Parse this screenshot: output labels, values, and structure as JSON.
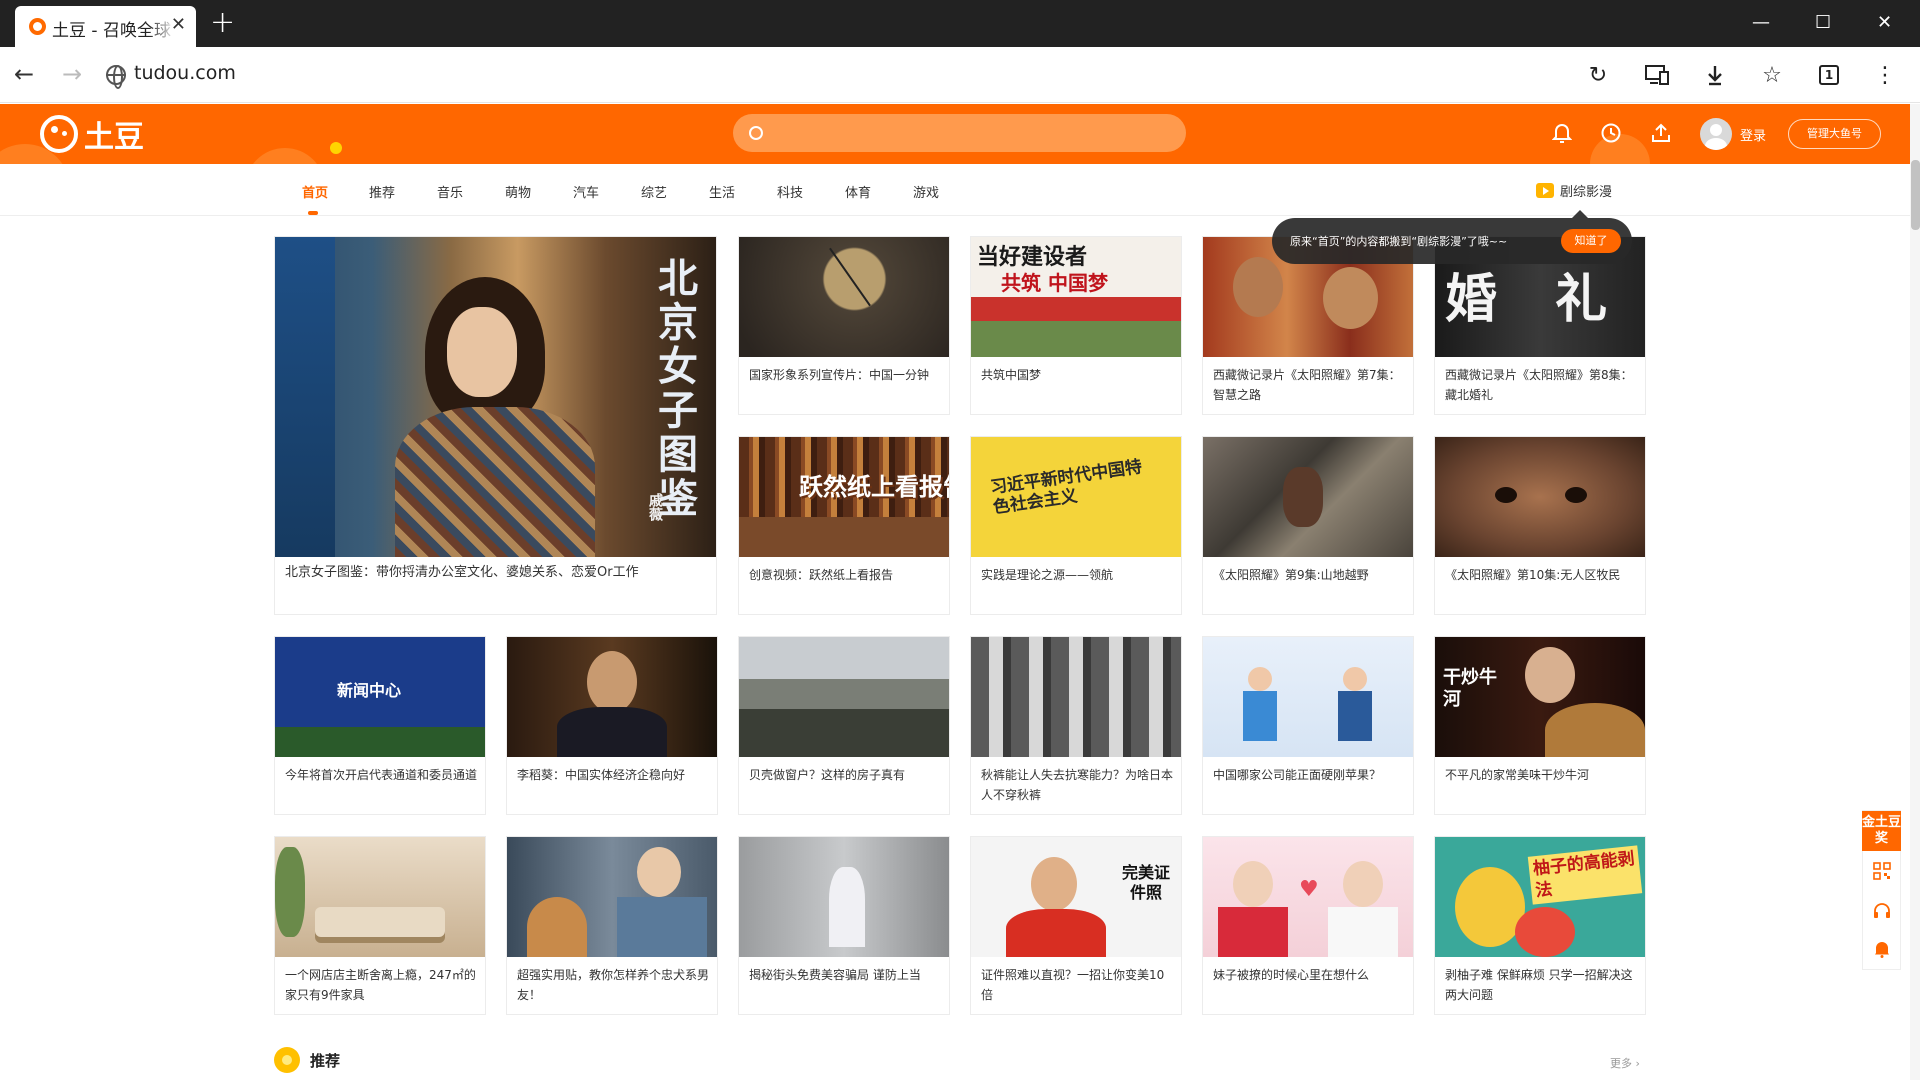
{
  "browser": {
    "tab_title": "土豆 - 召唤全球",
    "tab_close": "✕",
    "new_tab": "+",
    "url": "tudou.com",
    "win_minimize": "—",
    "win_maximize": "☐",
    "win_close": "✕",
    "tab_count": "1"
  },
  "header": {
    "logo_text": "土豆",
    "search_placeholder": "",
    "login_label": "登录",
    "manager_button": "管理大鱼号"
  },
  "nav": {
    "items": [
      "首页",
      "推荐",
      "音乐",
      "萌物",
      "汽车",
      "综艺",
      "生活",
      "科技",
      "体育",
      "游戏"
    ],
    "active_index": 0,
    "drama_label": "剧综影漫"
  },
  "tooltip": {
    "text": "原来“首页”的内容都搬到“剧综影漫”了哦~~",
    "button": "知道了"
  },
  "videos": {
    "featured": {
      "title": "北京女子图鉴：带你捋清办公室文化、婆媳关系、恋爱Or工作",
      "overlay": "北京女子图鉴",
      "overlay_credit": "戚薇"
    },
    "row1": [
      {
        "title": "国家形象系列宣传片：中国一分钟"
      },
      {
        "title": "共筑中国梦",
        "overlay_top": "当好建设者",
        "overlay_bottom": "共筑 中国梦"
      },
      {
        "title": "西藏微记录片《太阳照耀》第7集：智慧之路"
      },
      {
        "title": "西藏微记录片《太阳照耀》第8集：藏北婚礼",
        "overlay": "婚 礼"
      }
    ],
    "row2": [
      {
        "title": "创意视频：跃然纸上看报告",
        "overlay": "跃然纸上看报告"
      },
      {
        "title": "实践是理论之源——领航",
        "overlay": "习近平新时代中国特色社会主义"
      },
      {
        "title": "《太阳照耀》第9集:山地越野"
      },
      {
        "title": "《太阳照耀》第10集:无人区牧民"
      }
    ],
    "row3": [
      {
        "title": "今年将首次开启代表通道和委员通道",
        "overlay": "新闻中心"
      },
      {
        "title": "李稻葵：中国实体经济企稳向好"
      },
      {
        "title": "贝壳做窗户？这样的房子真有"
      },
      {
        "title": "秋裤能让人失去抗寒能力？为啥日本人不穿秋裤"
      },
      {
        "title": "中国哪家公司能正面硬刚苹果？"
      },
      {
        "title": "不平凡的家常美味干炒牛河",
        "overlay": "干炒牛河"
      }
    ],
    "row4": [
      {
        "title": "一个网店店主断舍离上瘾，247㎡的家只有9件家具"
      },
      {
        "title": "超强实用贴，教你怎样养个忠犬系男友！"
      },
      {
        "title": "揭秘街头免费美容骗局 谨防上当"
      },
      {
        "title": "证件照难以直视？一招让你变美10倍",
        "overlay": "完美证件照"
      },
      {
        "title": "妹子被撩的时候心里在想什么"
      },
      {
        "title": "剥柚子难 保鲜麻烦 只学一招解决这两大问题",
        "overlay": "柚子的高能剥法"
      }
    ]
  },
  "section": {
    "title": "推荐",
    "more": "更多 ›"
  },
  "side_widget": {
    "label": "金土豆奖"
  },
  "colors": {
    "brand": "#ff6700",
    "tab_bar": "#222222"
  },
  "icons": [
    "back-arrow-icon",
    "forward-arrow-icon",
    "globe-icon",
    "reload-icon",
    "devices-icon",
    "download-icon",
    "star-icon",
    "tab-count-icon",
    "more-vert-icon",
    "search-icon",
    "bell-icon",
    "history-icon",
    "upload-icon",
    "avatar-icon",
    "qrcode-icon",
    "headset-icon"
  ]
}
